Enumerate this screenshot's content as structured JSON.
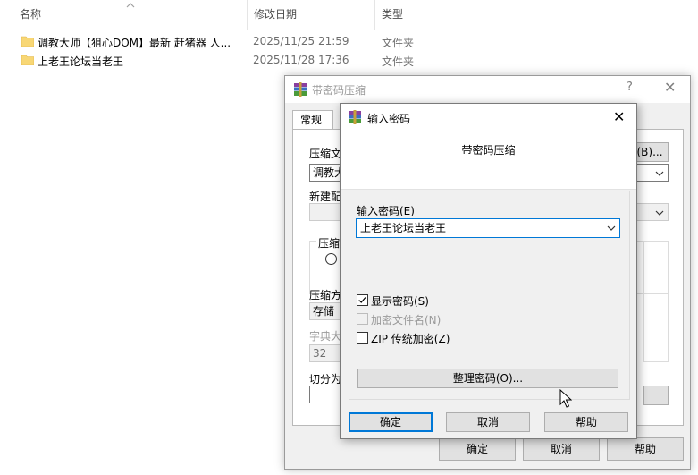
{
  "explorer": {
    "columns": {
      "name": "名称",
      "date": "修改日期",
      "type": "类型"
    },
    "files": [
      {
        "name": "调教大师【狙心DOM】最新 赶猪器 人...",
        "date": "2025/11/25 21:59",
        "type": "文件夹"
      },
      {
        "name": "上老王论坛当老王",
        "date": "2025/11/28 17:36",
        "type": "文件夹"
      }
    ]
  },
  "back_dialog": {
    "title": "带密码压缩",
    "help_glyph": "?",
    "tab_general": "常规",
    "archive_name_label": "压缩文",
    "archive_name_value": "调教大",
    "browse_label": "(B)...",
    "new_profile_label": "新建配",
    "format_group_label": "压缩文",
    "method_label": "压缩方",
    "method_value": "存储",
    "dict_label": "字典大",
    "dict_value": "32",
    "split_label": "切分为",
    "ok": "确定",
    "cancel": "取消",
    "help": "帮助"
  },
  "dialog": {
    "title": "输入密码",
    "banner_heading": "带密码压缩",
    "password_label": "输入密码(E)",
    "password_value": "上老王论坛当老王",
    "show_password": {
      "label": "显示密码(S)",
      "checked": true
    },
    "encrypt_filenames": {
      "label": "加密文件名(N)",
      "checked": false,
      "disabled": true
    },
    "zip_legacy": {
      "label": "ZIP 传统加密(Z)",
      "checked": false
    },
    "organize_button": "整理密码(O)...",
    "ok": "确定",
    "cancel": "取消",
    "help": "帮助"
  },
  "colors": {
    "accent": "#0078d7",
    "folder": "#f8d775",
    "button_face": "#e1e1e1"
  }
}
